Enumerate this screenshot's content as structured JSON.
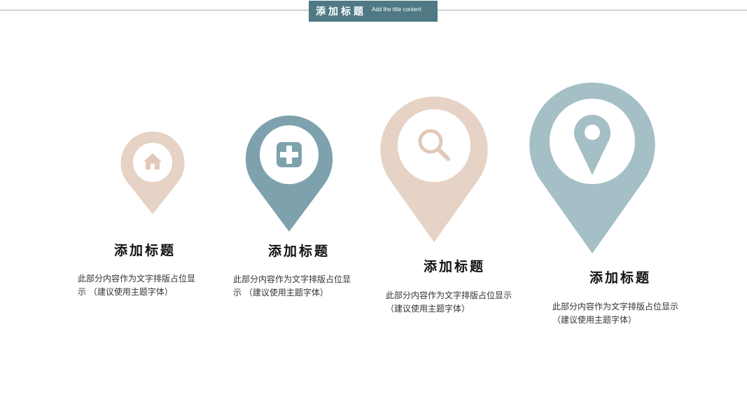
{
  "header": {
    "title": "添加标题",
    "subtitle": "Add the title content"
  },
  "colors": {
    "beige": "#e6d3c6",
    "teal_dark": "#7ea2ad",
    "teal_light": "#a4bfc5",
    "header_bg": "#4f7a85"
  },
  "items": [
    {
      "title": "添加标题",
      "desc_line1": "此部分内容作为文字排版占位显",
      "desc_line2": "示 （建议使用主题字体）",
      "icon": "home-icon"
    },
    {
      "title": "添加标题",
      "desc_line1": "此部分内容作为文字排版占位显",
      "desc_line2": "示 （建议使用主题字体）",
      "icon": "plus-icon"
    },
    {
      "title": "添加标题",
      "desc_line1": "此部分内容作为文字排版占位显示",
      "desc_line2": "（建议使用主题字体）",
      "icon": "search-icon"
    },
    {
      "title": "添加标题",
      "desc_line1": "此部分内容作为文字排版占位显示",
      "desc_line2": "（建议使用主题字体）",
      "icon": "location-pin-icon"
    }
  ]
}
